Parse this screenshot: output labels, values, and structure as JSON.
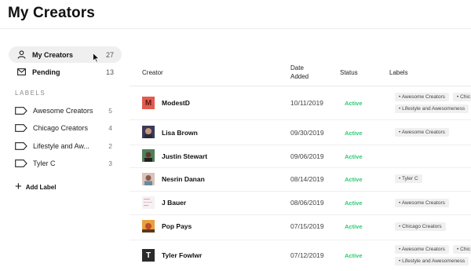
{
  "page": {
    "title": "My Creators"
  },
  "sidebar": {
    "nav": [
      {
        "label": "My Creators",
        "count": "27",
        "icon": "person-icon",
        "active": true
      },
      {
        "label": "Pending",
        "count": "13",
        "icon": "mail-icon",
        "active": false
      }
    ],
    "labels_heading": "LABELS",
    "labels": [
      {
        "name": "Awesome Creators",
        "count": "5"
      },
      {
        "name": "Chicago Creators",
        "count": "4"
      },
      {
        "name": "Lifestyle and Aw...",
        "count": "2"
      },
      {
        "name": "Tyler C",
        "count": "3"
      }
    ],
    "add_label": "Add Label"
  },
  "table": {
    "headers": {
      "creator": "Creator",
      "date_added_1": "Date",
      "date_added_2": "Added",
      "status": "Status",
      "labels": "Labels"
    },
    "rows": [
      {
        "name": "ModestD",
        "date": "10/11/2019",
        "status": "Active",
        "avatar": "M",
        "avatar_color": "#e35b4f",
        "labels": [
          "• Awesome Creators",
          "• Chic",
          "• Lifestyle and Awesomeness"
        ]
      },
      {
        "name": "Lisa Brown",
        "date": "09/30/2019",
        "status": "Active",
        "avatar": "",
        "avatar_color": "#7a4a3a",
        "labels": [
          "• Awesome Creators"
        ]
      },
      {
        "name": "Justin Stewart",
        "date": "09/06/2019",
        "status": "Active",
        "avatar": "",
        "avatar_color": "#3c6a4a",
        "labels": []
      },
      {
        "name": "Nesrin Danan",
        "date": "08/14/2019",
        "status": "Active",
        "avatar": "",
        "avatar_color": "#b88a78",
        "labels": [
          "• Tyler C"
        ]
      },
      {
        "name": "J Bauer",
        "date": "08/06/2019",
        "status": "Active",
        "avatar": "",
        "avatar_color": "#f3eef0",
        "labels": [
          "• Awesome Creators"
        ]
      },
      {
        "name": "Pop Pays",
        "date": "07/15/2019",
        "status": "Active",
        "avatar": "",
        "avatar_color": "#e79b3a",
        "labels": [
          "• Chicago Creators"
        ]
      },
      {
        "name": "Tyler Fowlwr",
        "date": "07/12/2019",
        "status": "Active",
        "avatar": "T",
        "avatar_color": "#2b2b2b",
        "labels": [
          "• Awesome Creators",
          "• Chic",
          "• Lifestyle and Awesomeness"
        ]
      }
    ]
  },
  "colors": {
    "status_active": "#2ecc71",
    "nav_active_bg": "#efefef",
    "chip_bg": "#f0f0f0"
  }
}
